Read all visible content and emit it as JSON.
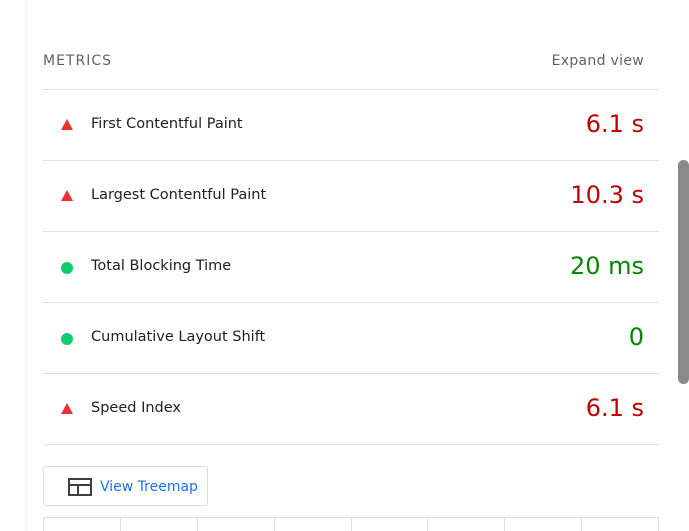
{
  "metrics": {
    "title": "METRICS",
    "expand_label": "Expand view",
    "items": [
      {
        "label": "First Contentful Paint",
        "value": "6.1 s",
        "status": "fail"
      },
      {
        "label": "Largest Contentful Paint",
        "value": "10.3 s",
        "status": "fail"
      },
      {
        "label": "Total Blocking Time",
        "value": "20 ms",
        "status": "pass"
      },
      {
        "label": "Cumulative Layout Shift",
        "value": "0",
        "status": "pass"
      },
      {
        "label": "Speed Index",
        "value": "6.1 s",
        "status": "fail"
      }
    ]
  },
  "treemap": {
    "label": "View Treemap",
    "icon": "treemap-icon"
  },
  "colors": {
    "fail": "#eb3131",
    "fail_value": "#c00000",
    "pass": "#0cce6b",
    "pass_value": "#008800",
    "link": "#1a73e8"
  }
}
